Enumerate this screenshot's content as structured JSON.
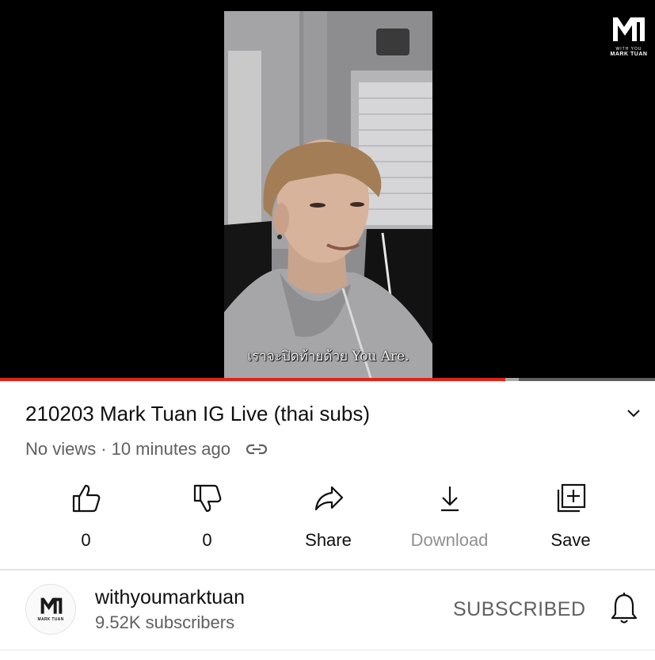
{
  "player": {
    "subtitle": "เราจะปิดท้ายด้วย You Are.",
    "watermark": {
      "tagline": "WITH YOU",
      "name": "MARK TUAN"
    },
    "progress": {
      "played_fraction": 0.772,
      "buffered_fraction": 0.792
    }
  },
  "video": {
    "title": "210203 Mark Tuan IG Live (thai subs)",
    "views": "No views",
    "separator": "·",
    "age": "10 minutes ago"
  },
  "actions": [
    {
      "label": "0",
      "icon": "like-icon",
      "enabled": true
    },
    {
      "label": "0",
      "icon": "dislike-icon",
      "enabled": true
    },
    {
      "label": "Share",
      "icon": "share-icon",
      "enabled": true
    },
    {
      "label": "Download",
      "icon": "download-icon",
      "enabled": false
    },
    {
      "label": "Save",
      "icon": "save-to-playlist-icon",
      "enabled": true
    }
  ],
  "channel": {
    "name": "withyoumarktuan",
    "subscribers": "9.52K subscribers",
    "subscribe_label": "SUBSCRIBED",
    "avatar_text": "MARK TUAN"
  },
  "colors": {
    "accent": "#e62117",
    "secondary_text": "#606060",
    "disabled_text": "#909090"
  }
}
